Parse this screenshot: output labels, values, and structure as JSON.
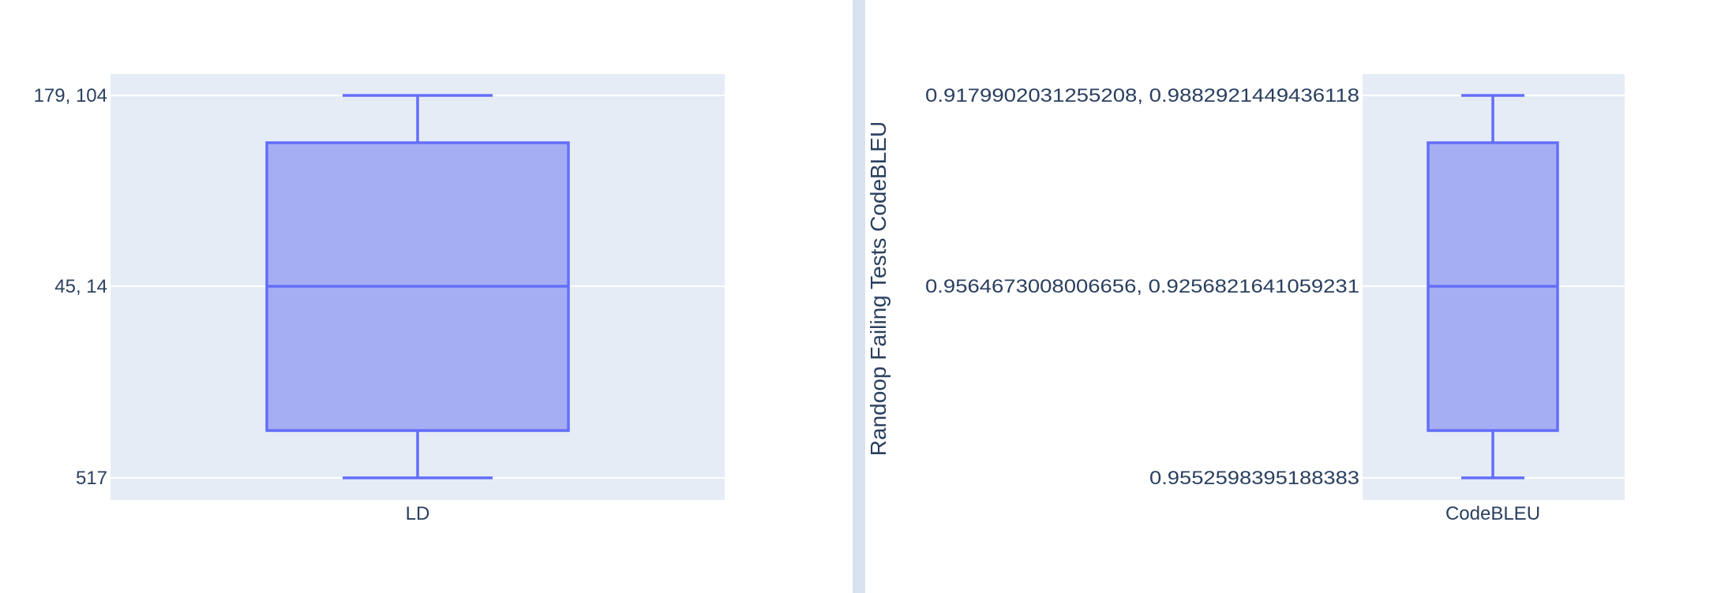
{
  "chart_data": [
    {
      "type": "box",
      "title": "",
      "xlabel": "",
      "ylabel": "",
      "categories": [
        "LD"
      ],
      "y_tick_labels": [
        "179, 104",
        "45, 14",
        "517"
      ],
      "box": {
        "category": "LD",
        "whisker_high": "179, 104",
        "q3": "",
        "median": "45, 14",
        "q1": "",
        "whisker_low": "517"
      },
      "grid": true,
      "legend": false
    },
    {
      "type": "box",
      "title": "",
      "xlabel": "",
      "ylabel": "Randoop Failing Tests CodeBLEU",
      "categories": [
        "CodeBLEU"
      ],
      "y_tick_labels": [
        "0.9179902031255208, 0.9882921449436118",
        "0.9564673008006656, 0.9256821641059231",
        "0.9552598395188383"
      ],
      "box": {
        "category": "CodeBLEU",
        "whisker_high": "0.9179902031255208, 0.9882921449436118",
        "q3": "",
        "median": "0.9564673008006656, 0.9256821641059231",
        "q1": "",
        "whisker_low": "0.9552598395188383"
      },
      "grid": true,
      "legend": false
    }
  ],
  "colors": {
    "plot_bg": "#e5ecf6",
    "box_fill": "#a5aef2",
    "box_line": "#636efa",
    "grid": "#ffffff",
    "text": "#2a3f5f",
    "divider": "#d9e3ef"
  }
}
